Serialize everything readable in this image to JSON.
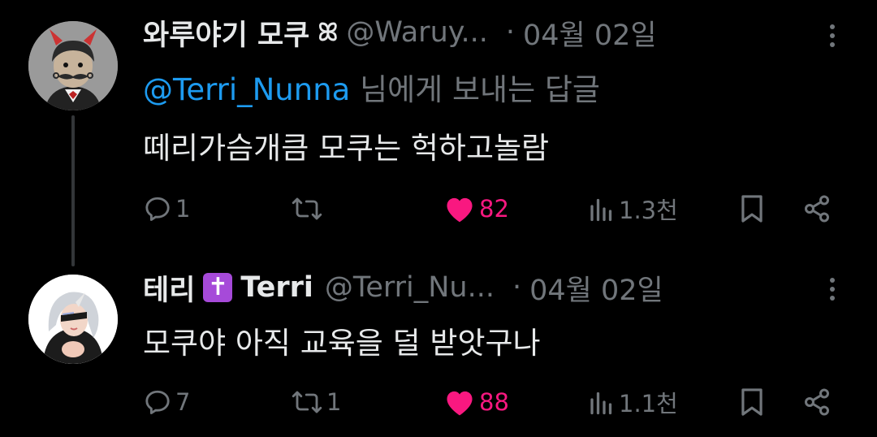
{
  "colors": {
    "background": "#000000",
    "text": "#e7e9ea",
    "secondary": "#71767b",
    "mention": "#1d9bf0",
    "like": "#f91880",
    "thread_line": "#333639"
  },
  "tweets": [
    {
      "display_name": "와루야기 모쿠",
      "name_decoration": "ꕤ",
      "handle": "@Waruy...",
      "separator": "·",
      "date": "04월 02일",
      "reply_to": {
        "mention": "@Terri_Nunna",
        "suffix": " 님에게 보내는 답글"
      },
      "text": "떼리가슴개큼 모쿠는 헉하고놀람",
      "stats": {
        "replies": "1",
        "retweets": "",
        "likes": "82",
        "views": "1.3천"
      },
      "icons": {
        "reply": "reply-icon",
        "retweet": "retweet-icon",
        "like": "heart-filled-icon",
        "views": "views-chart-icon",
        "bookmark": "bookmark-icon",
        "share": "share-icon",
        "more": "more-vertical-icon"
      }
    },
    {
      "display_name": "테리",
      "name_emoji": "✝",
      "name_suffix": "Terri",
      "handle": "@Terri_Nu...",
      "separator": "·",
      "date": "04월 02일",
      "text": "모쿠야 아직 교육을 덜 받앗구나",
      "stats": {
        "replies": "7",
        "retweets": "1",
        "likes": "88",
        "views": "1.1천"
      },
      "icons": {
        "reply": "reply-icon",
        "retweet": "retweet-icon",
        "like": "heart-filled-icon",
        "views": "views-chart-icon",
        "bookmark": "bookmark-icon",
        "share": "share-icon",
        "more": "more-vertical-icon"
      }
    }
  ]
}
